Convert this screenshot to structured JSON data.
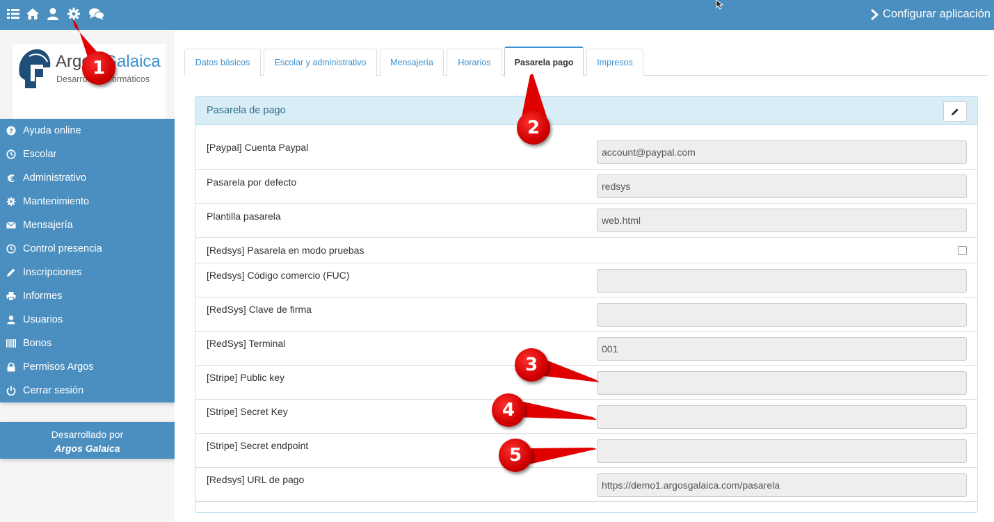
{
  "topbar": {
    "icons": [
      "list-icon",
      "home-icon",
      "user-icon",
      "gear-icon",
      "chat-icon"
    ],
    "title": "Configurar aplicación"
  },
  "logo": {
    "brand_a": "Argos ",
    "brand_b": "Galaica",
    "subtitle": "Desarrollos informáticos"
  },
  "sidebar": {
    "items": [
      {
        "label": "Ayuda online",
        "icon": "question-icon"
      },
      {
        "label": "Escolar",
        "icon": "clock-icon"
      },
      {
        "label": "Administrativo",
        "icon": "euro-icon"
      },
      {
        "label": "Mantenimiento",
        "icon": "gear-icon"
      },
      {
        "label": "Mensajería",
        "icon": "envelope-icon"
      },
      {
        "label": "Control presencia",
        "icon": "clock-icon"
      },
      {
        "label": "Inscripciones",
        "icon": "pencil-icon"
      },
      {
        "label": "Informes",
        "icon": "printer-icon"
      },
      {
        "label": "Usuarios",
        "icon": "user-icon"
      },
      {
        "label": "Bonos",
        "icon": "barcode-icon"
      },
      {
        "label": "Permisos Argos",
        "icon": "lock-icon"
      },
      {
        "label": "Cerrar sesión",
        "icon": "power-icon"
      }
    ]
  },
  "credit": {
    "line1": "Desarrollado por",
    "line2": "Argos Galaica"
  },
  "tabs": [
    {
      "label": "Datos básicos",
      "active": false
    },
    {
      "label": "Escolar y administrativo",
      "active": false
    },
    {
      "label": "Mensajería",
      "active": false
    },
    {
      "label": "Horarios",
      "active": false
    },
    {
      "label": "Pasarela pago",
      "active": true
    },
    {
      "label": "Impresos",
      "active": false
    }
  ],
  "panel": {
    "title": "Pasarela de pago",
    "rows": [
      {
        "label": "[Paypal] Cuenta Paypal",
        "value": "account@paypal.com",
        "kind": "field"
      },
      {
        "label": "Pasarela por defecto",
        "value": "redsys",
        "kind": "field"
      },
      {
        "label": "Plantilla pasarela",
        "value": "web.html",
        "kind": "field"
      },
      {
        "label": "[Redsys] Pasarela en modo pruebas",
        "value": "",
        "kind": "checkbox"
      },
      {
        "label": "[Redsys] Código comercio (FUC)",
        "value": "",
        "kind": "field"
      },
      {
        "label": "[RedSys] Clave de firma",
        "value": "",
        "kind": "field"
      },
      {
        "label": "[RedSys] Terminal",
        "value": "001",
        "kind": "field"
      },
      {
        "label": "[Stripe] Public key",
        "value": "",
        "kind": "field"
      },
      {
        "label": "[Stripe] Secret Key",
        "value": "",
        "kind": "field"
      },
      {
        "label": "[Stripe] Secret endpoint",
        "value": "",
        "kind": "field"
      },
      {
        "label": "[Redsys] URL de pago",
        "value": "https://demo1.argosgalaica.com/pasarela",
        "kind": "field"
      }
    ]
  },
  "callouts": [
    "1",
    "2",
    "3",
    "4",
    "5"
  ],
  "colors": {
    "primary": "#4a8fc0",
    "panel_head": "#d9edf7",
    "callout": "#d00000"
  }
}
